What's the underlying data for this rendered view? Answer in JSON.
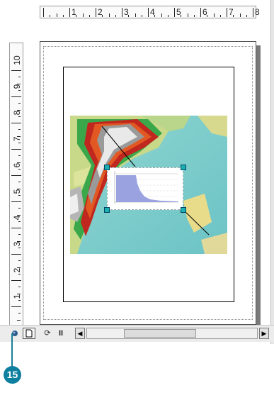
{
  "ruler": {
    "horizontal_labels": [
      "1",
      "2",
      "3",
      "4",
      "5",
      "6",
      "7",
      "8"
    ],
    "vertical_labels": [
      "10",
      "9",
      "8",
      "7",
      "6",
      "5",
      "4",
      "3",
      "2",
      "1"
    ]
  },
  "toolbar": {
    "layout_view_icon": "page-icon",
    "refresh_icon": "refresh-icon",
    "pause_icon": "pause-icon",
    "scroll_left": "◀",
    "scroll_right": "▶",
    "pause_glyph": "II",
    "refresh_glyph": "⟳"
  },
  "callout": {
    "number": "15"
  },
  "colors": {
    "callout": "#0e7f9f",
    "handle": "#1ab0b0",
    "graph_fill": "#9aa3e0"
  }
}
